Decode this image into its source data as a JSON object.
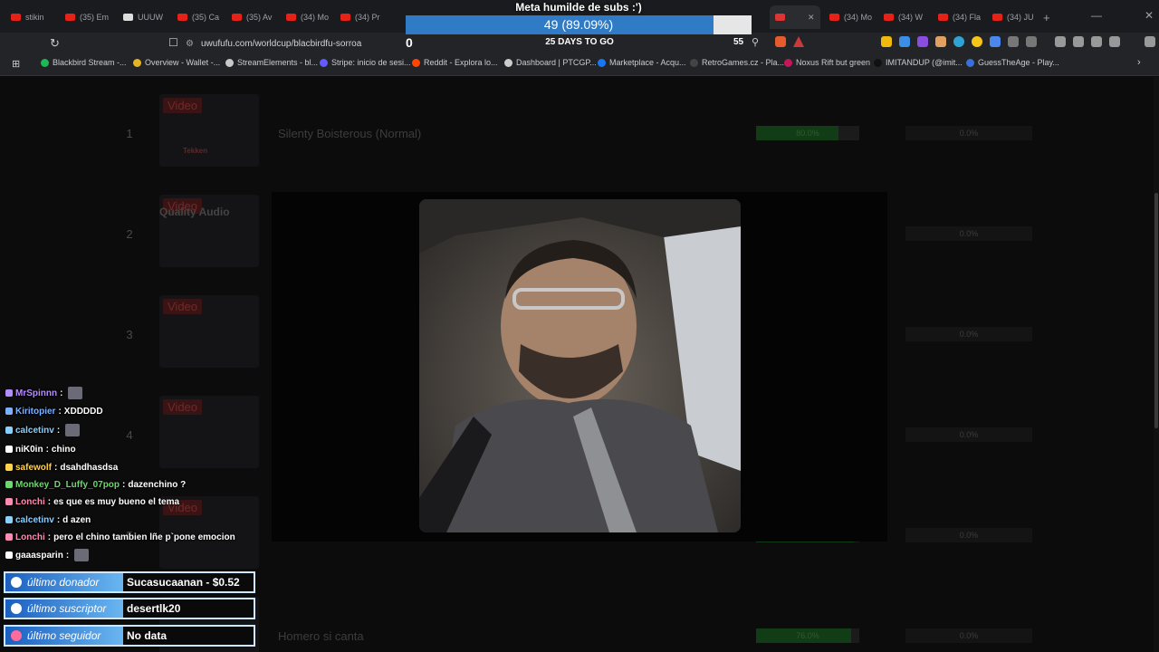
{
  "browser": {
    "tabs": [
      {
        "label": "stikin"
      },
      {
        "label": "(35) Em"
      },
      {
        "label": "UUUW"
      },
      {
        "label": "(35) Ca"
      },
      {
        "label": "(35) Av"
      },
      {
        "label": "(34) Mo"
      },
      {
        "label": "(34) Pr"
      },
      {
        "label": "(34) Mo"
      },
      {
        "label": "(34) W"
      },
      {
        "label": "(34) Fla"
      },
      {
        "label": "(34) JU"
      }
    ],
    "new_tab": "+",
    "url": "uwufufu.com/worldcup/blacbirdfu-sorroa",
    "bookmarks": [
      {
        "label": "Blackbird Stream -...",
        "color": "#1db954"
      },
      {
        "label": "Overview - Wallet -...",
        "color": "#e6b422"
      },
      {
        "label": "StreamElements - bl...",
        "color": "#c9c9c9"
      },
      {
        "label": "Stripe: inicio de sesi...",
        "color": "#635bff"
      },
      {
        "label": "Reddit - Explora lo...",
        "color": "#ff4500"
      },
      {
        "label": "Dashboard | PTCGP...",
        "color": "#cccccc"
      },
      {
        "label": "Marketplace - Acqu...",
        "color": "#1877f2"
      },
      {
        "label": "RetroGames.cz - Pla...",
        "color": "#444444"
      },
      {
        "label": "Noxus Rift but green",
        "color": "#c2185b"
      },
      {
        "label": "IMITANDUP (@imit...",
        "color": "#111111"
      },
      {
        "label": "GuessTheAge - Play...",
        "color": "#3b6fd8"
      }
    ]
  },
  "overlay": {
    "goal_title": "Meta humilde de subs :')",
    "goal_text": "49 (89.09%)",
    "goal_progress": 0.8909,
    "goal_start": "0",
    "goal_days": "25 DAYS TO GO",
    "goal_target": "55"
  },
  "worldcup": {
    "video_badge": "Video",
    "rows": [
      {
        "rank": "1",
        "name": "Silenty Boisterous (Normal)",
        "win_pct": "80.0%",
        "win_fill": 0.8,
        "other_pct": "0.0%"
      },
      {
        "rank": "2",
        "name": "",
        "win_pct": "",
        "win_fill": 0,
        "other_pct": "0.0%"
      },
      {
        "rank": "3",
        "name": "",
        "win_pct": "",
        "win_fill": 0,
        "other_pct": "0.0%"
      },
      {
        "rank": "4",
        "name": "",
        "win_pct": "",
        "win_fill": 0,
        "other_pct": "0.0%"
      },
      {
        "rank": "5",
        "name": "",
        "win_pct": "",
        "win_fill": 0.95,
        "other_pct": "0.0%"
      },
      {
        "rank": "6",
        "name": "Homero si canta",
        "win_pct": "76.0%",
        "win_fill": 0.92,
        "other_pct": "0.0%"
      }
    ],
    "thumb_text": "Tekken",
    "thumb2_text": "Quality Audio"
  },
  "chat": [
    {
      "user": "MrSpinnn",
      "text": "",
      "color": "#b48cff",
      "emote": true
    },
    {
      "user": "Kiritopier",
      "text": "XDDDDD",
      "color": "#7fb0ff",
      "emote": false
    },
    {
      "user": "calcetinv",
      "text": "",
      "color": "#8ad0ff",
      "emote": true
    },
    {
      "user": "niK0in",
      "text": "chino",
      "color": "#ffffff",
      "emote": false
    },
    {
      "user": "safewolf",
      "text": "dsahdhasdsa",
      "color": "#ffd24a",
      "emote": false
    },
    {
      "user": "Monkey_D_Luffy_07pop",
      "text": "dazenchino ?",
      "color": "#6dd86d",
      "emote": false
    },
    {
      "user": "Lonchi",
      "text": "es que es muy bueno el tema",
      "color": "#ff8ab4",
      "emote": false
    },
    {
      "user": "calcetinv",
      "text": "d azen",
      "color": "#8ad0ff",
      "emote": false
    },
    {
      "user": "Lonchi",
      "text": "pero el chino tambien lñe p`pone emocion",
      "color": "#ff8ab4",
      "emote": false
    },
    {
      "user": "gaaasparin",
      "text": "",
      "color": "#ffffff",
      "emote": true
    }
  ],
  "alerts": [
    {
      "label": "último donador",
      "value": "Sucasucaanan - $0.52"
    },
    {
      "label": "último suscriptor",
      "value": "desertlk20"
    },
    {
      "label": "último seguidor",
      "value": "No data"
    }
  ]
}
